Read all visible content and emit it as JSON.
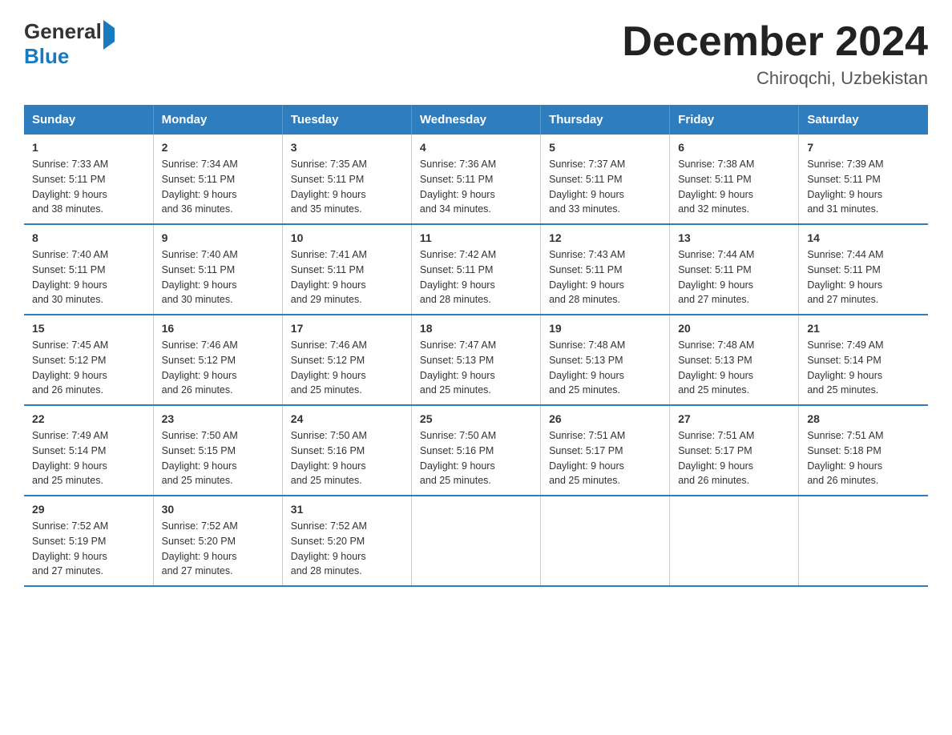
{
  "header": {
    "logo_general": "General",
    "logo_blue": "Blue",
    "title": "December 2024",
    "subtitle": "Chiroqchi, Uzbekistan"
  },
  "weekdays": [
    "Sunday",
    "Monday",
    "Tuesday",
    "Wednesday",
    "Thursday",
    "Friday",
    "Saturday"
  ],
  "weeks": [
    [
      {
        "day": "1",
        "sunrise": "7:33 AM",
        "sunset": "5:11 PM",
        "daylight": "9 hours and 38 minutes."
      },
      {
        "day": "2",
        "sunrise": "7:34 AM",
        "sunset": "5:11 PM",
        "daylight": "9 hours and 36 minutes."
      },
      {
        "day": "3",
        "sunrise": "7:35 AM",
        "sunset": "5:11 PM",
        "daylight": "9 hours and 35 minutes."
      },
      {
        "day": "4",
        "sunrise": "7:36 AM",
        "sunset": "5:11 PM",
        "daylight": "9 hours and 34 minutes."
      },
      {
        "day": "5",
        "sunrise": "7:37 AM",
        "sunset": "5:11 PM",
        "daylight": "9 hours and 33 minutes."
      },
      {
        "day": "6",
        "sunrise": "7:38 AM",
        "sunset": "5:11 PM",
        "daylight": "9 hours and 32 minutes."
      },
      {
        "day": "7",
        "sunrise": "7:39 AM",
        "sunset": "5:11 PM",
        "daylight": "9 hours and 31 minutes."
      }
    ],
    [
      {
        "day": "8",
        "sunrise": "7:40 AM",
        "sunset": "5:11 PM",
        "daylight": "9 hours and 30 minutes."
      },
      {
        "day": "9",
        "sunrise": "7:40 AM",
        "sunset": "5:11 PM",
        "daylight": "9 hours and 30 minutes."
      },
      {
        "day": "10",
        "sunrise": "7:41 AM",
        "sunset": "5:11 PM",
        "daylight": "9 hours and 29 minutes."
      },
      {
        "day": "11",
        "sunrise": "7:42 AM",
        "sunset": "5:11 PM",
        "daylight": "9 hours and 28 minutes."
      },
      {
        "day": "12",
        "sunrise": "7:43 AM",
        "sunset": "5:11 PM",
        "daylight": "9 hours and 28 minutes."
      },
      {
        "day": "13",
        "sunrise": "7:44 AM",
        "sunset": "5:11 PM",
        "daylight": "9 hours and 27 minutes."
      },
      {
        "day": "14",
        "sunrise": "7:44 AM",
        "sunset": "5:11 PM",
        "daylight": "9 hours and 27 minutes."
      }
    ],
    [
      {
        "day": "15",
        "sunrise": "7:45 AM",
        "sunset": "5:12 PM",
        "daylight": "9 hours and 26 minutes."
      },
      {
        "day": "16",
        "sunrise": "7:46 AM",
        "sunset": "5:12 PM",
        "daylight": "9 hours and 26 minutes."
      },
      {
        "day": "17",
        "sunrise": "7:46 AM",
        "sunset": "5:12 PM",
        "daylight": "9 hours and 25 minutes."
      },
      {
        "day": "18",
        "sunrise": "7:47 AM",
        "sunset": "5:13 PM",
        "daylight": "9 hours and 25 minutes."
      },
      {
        "day": "19",
        "sunrise": "7:48 AM",
        "sunset": "5:13 PM",
        "daylight": "9 hours and 25 minutes."
      },
      {
        "day": "20",
        "sunrise": "7:48 AM",
        "sunset": "5:13 PM",
        "daylight": "9 hours and 25 minutes."
      },
      {
        "day": "21",
        "sunrise": "7:49 AM",
        "sunset": "5:14 PM",
        "daylight": "9 hours and 25 minutes."
      }
    ],
    [
      {
        "day": "22",
        "sunrise": "7:49 AM",
        "sunset": "5:14 PM",
        "daylight": "9 hours and 25 minutes."
      },
      {
        "day": "23",
        "sunrise": "7:50 AM",
        "sunset": "5:15 PM",
        "daylight": "9 hours and 25 minutes."
      },
      {
        "day": "24",
        "sunrise": "7:50 AM",
        "sunset": "5:16 PM",
        "daylight": "9 hours and 25 minutes."
      },
      {
        "day": "25",
        "sunrise": "7:50 AM",
        "sunset": "5:16 PM",
        "daylight": "9 hours and 25 minutes."
      },
      {
        "day": "26",
        "sunrise": "7:51 AM",
        "sunset": "5:17 PM",
        "daylight": "9 hours and 25 minutes."
      },
      {
        "day": "27",
        "sunrise": "7:51 AM",
        "sunset": "5:17 PM",
        "daylight": "9 hours and 26 minutes."
      },
      {
        "day": "28",
        "sunrise": "7:51 AM",
        "sunset": "5:18 PM",
        "daylight": "9 hours and 26 minutes."
      }
    ],
    [
      {
        "day": "29",
        "sunrise": "7:52 AM",
        "sunset": "5:19 PM",
        "daylight": "9 hours and 27 minutes."
      },
      {
        "day": "30",
        "sunrise": "7:52 AM",
        "sunset": "5:20 PM",
        "daylight": "9 hours and 27 minutes."
      },
      {
        "day": "31",
        "sunrise": "7:52 AM",
        "sunset": "5:20 PM",
        "daylight": "9 hours and 28 minutes."
      },
      null,
      null,
      null,
      null
    ]
  ],
  "labels": {
    "sunrise": "Sunrise:",
    "sunset": "Sunset:",
    "daylight": "Daylight:"
  }
}
